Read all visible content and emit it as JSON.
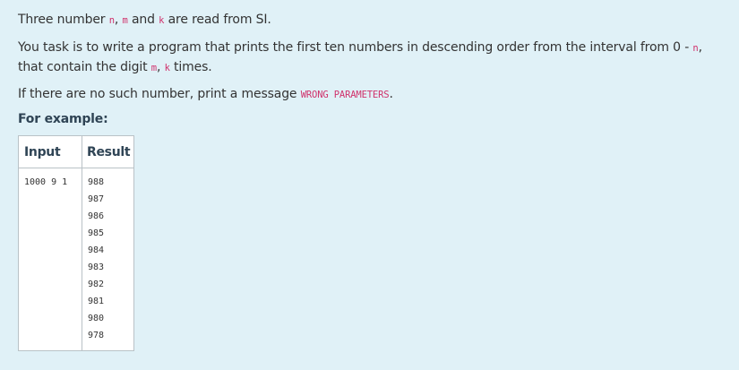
{
  "problem": {
    "line1": {
      "before": "Three number ",
      "var_n": "n",
      "comma": ", ",
      "var_m": "m",
      "and": " and ",
      "var_k": "k",
      "after": " are read from SI."
    },
    "line2": {
      "before": "You task is to write a program that prints the first ten numbers in descending order from the interval from 0 - ",
      "var_n": "n",
      "middle": ", that contain the digit ",
      "var_m": "m",
      "comma": ", ",
      "var_k": "k",
      "after": " times."
    },
    "line3": {
      "before": "If there are no such number, print a message ",
      "message": "WRONG PARAMETERS",
      "after": "."
    },
    "example_heading": "For example:"
  },
  "example_table": {
    "headers": {
      "input": "Input",
      "result": "Result"
    },
    "input": "1000 9 1",
    "result": "988\n987\n986\n985\n984\n983\n982\n981\n980\n978"
  }
}
